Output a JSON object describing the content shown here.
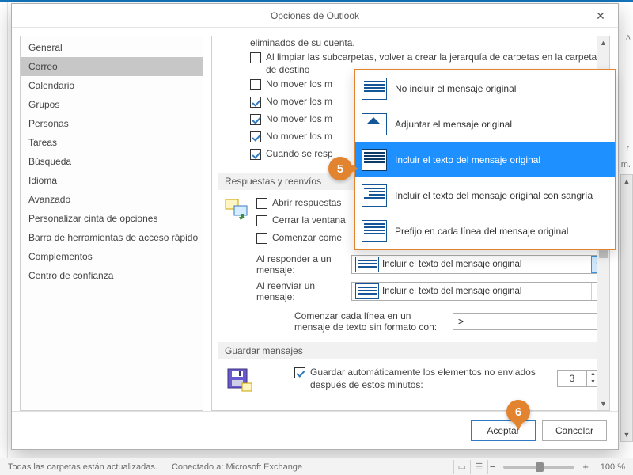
{
  "dialog": {
    "title": "Opciones de Outlook"
  },
  "sidebar": {
    "items": [
      "General",
      "Correo",
      "Calendario",
      "Grupos",
      "Personas",
      "Tareas",
      "Búsqueda",
      "Idioma",
      "Avanzado",
      "Personalizar cinta de opciones",
      "Barra de herramientas de acceso rápido",
      "Complementos",
      "Centro de confianza"
    ],
    "selected_index": 1
  },
  "top_lines": {
    "deleted": "eliminados de su cuenta.",
    "clean_sub": "Al limpiar las subcarpetas, volver a crear la jerarquía de carpetas en la carpeta de destino",
    "nomove": "No mover los m",
    "when": "Cuando se resp"
  },
  "sections": {
    "replies": "Respuestas y reenvíos",
    "save": "Guardar mensajes"
  },
  "replies": {
    "open": "Abrir respuestas",
    "close": "Cerrar la ventana",
    "start": "Comenzar come",
    "reply_label": "Al responder a un mensaje:",
    "forward_label": "Al reenviar un mensaje:",
    "combo_value": "Incluir el texto del mensaje original",
    "prefix_label": "Comenzar cada línea en un mensaje de texto sin formato con:",
    "prefix_value": ">"
  },
  "save": {
    "autosave": "Guardar automáticamente los elementos no enviados después de estos minutos:",
    "minutes": "3"
  },
  "dropdown": {
    "options": [
      "No incluir el mensaje original",
      "Adjuntar el mensaje original",
      "Incluir el texto del mensaje original",
      "Incluir el texto del mensaje original con sangría",
      "Prefijo en cada línea del mensaje original"
    ],
    "selected_index": 2
  },
  "buttons": {
    "ok": "Aceptar",
    "cancel": "Cancelar"
  },
  "callouts": {
    "five": "5",
    "six": "6"
  },
  "status": {
    "folders": "Todas las carpetas están actualizadas.",
    "connected": "Conectado a: Microsoft Exchange",
    "zoom": "100 %"
  },
  "bg": {
    "r_letter": "r",
    "m_letter": "m."
  }
}
